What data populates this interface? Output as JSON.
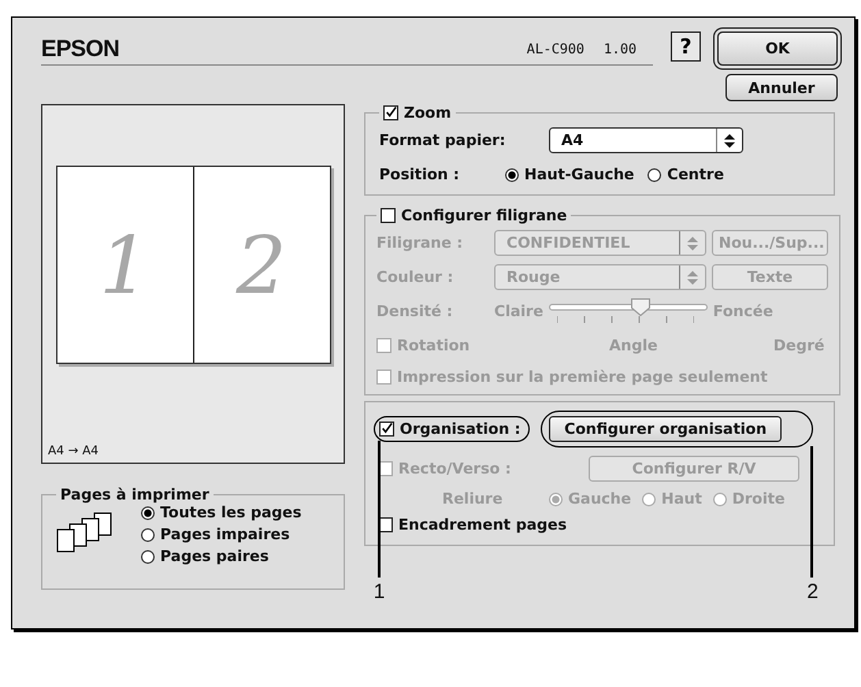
{
  "header": {
    "brand": "EPSON",
    "model": "AL-C900",
    "version": "1.00",
    "help": "?"
  },
  "buttons": [
    {
      "label": "OK",
      "default": true
    },
    {
      "label": "Annuler",
      "default": false
    }
  ],
  "preview": {
    "pages": [
      "1",
      "2"
    ],
    "caption": "A4 → A4"
  },
  "pages_group": {
    "title": "Pages à imprimer",
    "options": [
      {
        "label": "Toutes les pages",
        "selected": true
      },
      {
        "label": "Pages impaires",
        "selected": false
      },
      {
        "label": "Pages paires",
        "selected": false
      }
    ]
  },
  "zoom": {
    "label": "Zoom",
    "checked": true,
    "paper_label": "Format papier:",
    "paper_value": "A4",
    "position_label": "Position :",
    "positions": [
      {
        "label": "Haut-Gauche",
        "selected": true
      },
      {
        "label": "Centre",
        "selected": false
      }
    ]
  },
  "watermark": {
    "label": "Configurer filigrane",
    "checked": false,
    "disabled": true,
    "watermark_label": "Filigrane :",
    "watermark_value": "CONFIDENTIEL",
    "new_button": "Nou.../Sup...",
    "color_label": "Couleur :",
    "color_value": "Rouge",
    "text_button": "Texte",
    "density_label": "Densité :",
    "density_min": "Claire",
    "density_max": "Foncée",
    "density": {
      "level": 0.58
    },
    "rotation": {
      "label": "Rotation",
      "checked": false
    },
    "angle_label": "Angle",
    "degree_label": "Degré",
    "first_page": {
      "label": "Impression sur la première page seulement",
      "checked": false
    }
  },
  "layout": {
    "organisation": {
      "label": "Organisation :",
      "checked": true
    },
    "configure_button": "Configurer organisation",
    "duplex": {
      "label": "Recto/Verso :",
      "checked": false,
      "disabled": true
    },
    "duplex_button": "Configurer R/V",
    "binding_label": "Reliure",
    "binding": [
      {
        "label": "Gauche",
        "selected": true
      },
      {
        "label": "Haut",
        "selected": false
      },
      {
        "label": "Droite",
        "selected": false
      }
    ],
    "border": {
      "label": "Encadrement pages",
      "checked": false
    }
  },
  "callouts": [
    {
      "label": "1"
    },
    {
      "label": "2"
    }
  ]
}
